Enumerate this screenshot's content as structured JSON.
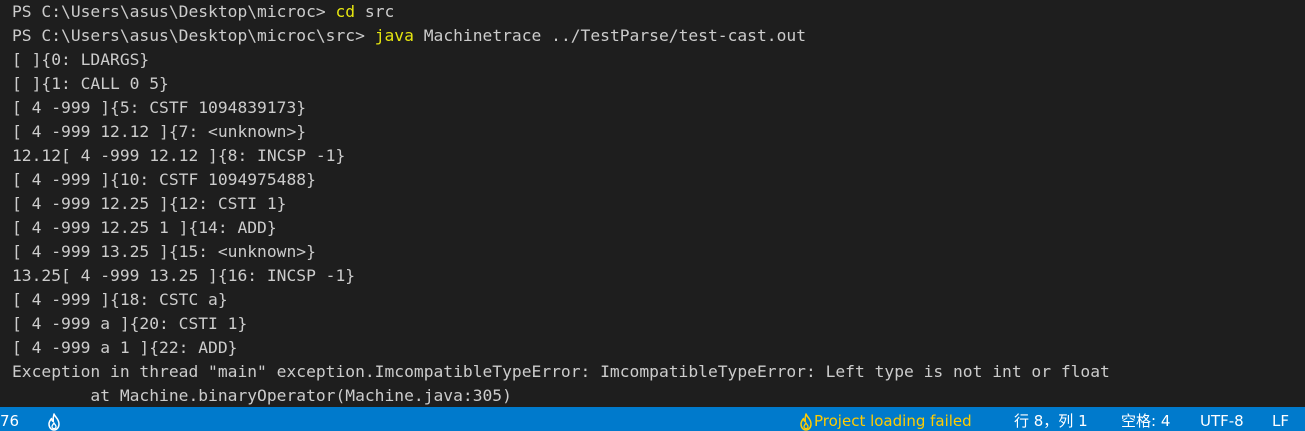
{
  "terminal": {
    "prompt1": "PS C:\\Users\\asus\\Desktop\\microc> ",
    "cmd1": "cd",
    "args1": " src",
    "prompt2": "PS C:\\Users\\asus\\Desktop\\microc\\src> ",
    "cmd2": "java",
    "args2": " Machinetrace ../TestParse/test-cast.out",
    "output": [
      "[ ]{0: LDARGS}",
      "[ ]{1: CALL 0 5}",
      "[ 4 -999 ]{5: CSTF 1094839173}",
      "[ 4 -999 12.12 ]{7: <unknown>}",
      "12.12[ 4 -999 12.12 ]{8: INCSP -1}",
      "[ 4 -999 ]{10: CSTF 1094975488}",
      "[ 4 -999 12.25 ]{12: CSTI 1}",
      "[ 4 -999 12.25 1 ]{14: ADD}",
      "[ 4 -999 13.25 ]{15: <unknown>}",
      "13.25[ 4 -999 13.25 ]{16: INCSP -1}",
      "[ 4 -999 ]{18: CSTC a}",
      "[ 4 -999 a ]{20: CSTI 1}",
      "[ 4 -999 a 1 ]{22: ADD}",
      "Exception in thread \"main\" exception.ImcompatibleTypeError: ImcompatibleTypeError: Left type is not int or float",
      "        at Machine.binaryOperator(Machine.java:305)"
    ]
  },
  "statusbar": {
    "left_number": "76",
    "left_icon": "flame-icon",
    "project_status": "Project loading failed",
    "cursor_position": "行 8，列 1",
    "indentation": "空格: 4",
    "encoding": "UTF-8",
    "eol": "LF"
  },
  "colors": {
    "background": "#1e1e1e",
    "text": "#cccccc",
    "command": "#e5e510",
    "statusbar": "#007acc",
    "warning": "#ffcc00"
  }
}
